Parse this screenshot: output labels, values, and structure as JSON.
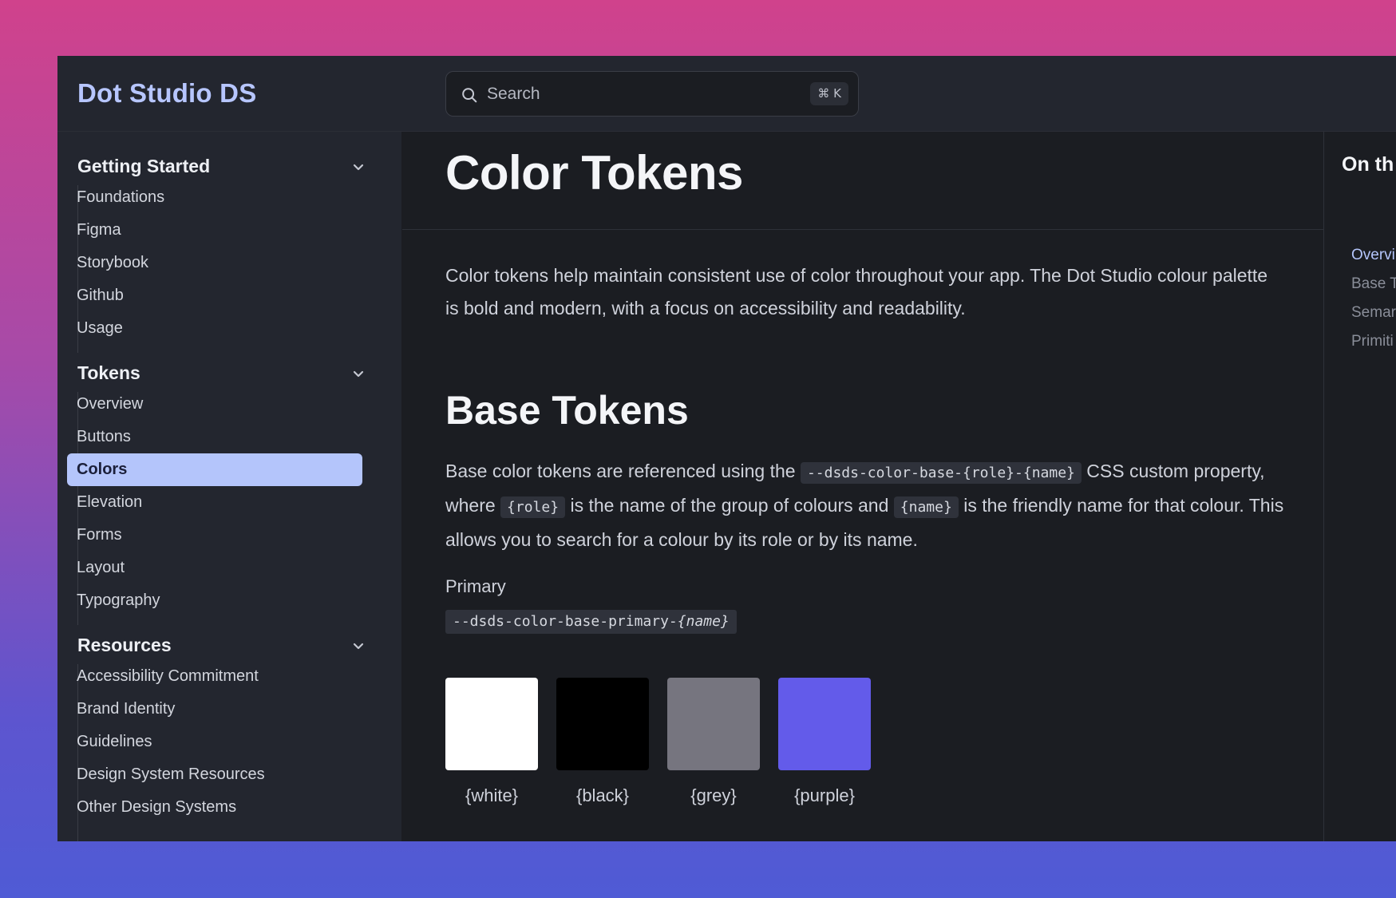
{
  "app": {
    "brand": "Dot Studio DS"
  },
  "search": {
    "placeholder": "Search",
    "shortcut": "⌘ K"
  },
  "sidebar": {
    "sections": [
      {
        "label": "Getting Started",
        "items": [
          "Foundations",
          "Figma",
          "Storybook",
          "Github",
          "Usage"
        ]
      },
      {
        "label": "Tokens",
        "items": [
          "Overview",
          "Buttons",
          "Colors",
          "Elevation",
          "Forms",
          "Layout",
          "Typography"
        ],
        "active": "Colors"
      },
      {
        "label": "Resources",
        "items": [
          "Accessibility Commitment",
          "Brand Identity",
          "Guidelines",
          "Design System Resources",
          "Other Design Systems"
        ]
      }
    ]
  },
  "main": {
    "title": "Color Tokens",
    "intro": "Color tokens help maintain consistent use of color throughout your app. The Dot Studio colour palette is bold and modern, with a focus on accessibility and readability.",
    "base_heading": "Base Tokens",
    "base_para": {
      "t1": "Base color tokens are referenced using the ",
      "c1": "--dsds-color-base-{role}-{name}",
      "t2": " CSS custom property, where ",
      "c2": "{role}",
      "t3": " is the name of the group of colours and ",
      "c3": "{name}",
      "t4": " is the friendly name for that colour. This allows you to search for a colour by its role or by its name."
    },
    "primary_label": "Primary",
    "primary_code": {
      "prefix": "--dsds-color-base-primary-",
      "var": "{name}"
    },
    "swatches": [
      {
        "label": "{white}",
        "color": "#ffffff"
      },
      {
        "label": "{black}",
        "color": "#000000"
      },
      {
        "label": "{grey}",
        "color": "#76757f"
      },
      {
        "label": "{purple}",
        "color": "#635bea"
      }
    ]
  },
  "toc": {
    "title": "On th",
    "items": [
      "Overvi",
      "Base T",
      "Semar",
      "Primiti"
    ],
    "active": "Overvi"
  },
  "colors": {
    "accent": "#b4c5fb",
    "brand": "#b7c6ff",
    "sidebar_bg": "#23262f",
    "content_bg": "#1b1d22"
  }
}
